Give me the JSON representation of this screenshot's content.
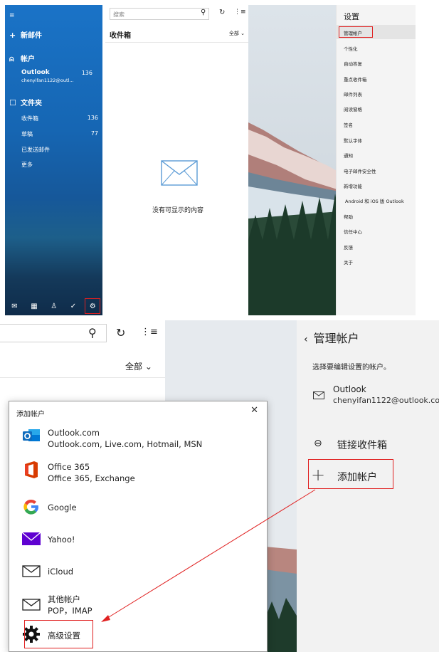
{
  "top": {
    "sidebar": {
      "new_mail": "新邮件",
      "accounts_header": "帐户",
      "account_name": "Outlook",
      "account_email": "chenyifan1122@outl...",
      "account_count": "136",
      "folders_header": "文件夹",
      "folders": [
        {
          "label": "收件箱",
          "count": "136"
        },
        {
          "label": "草稿",
          "count": "77"
        },
        {
          "label": "已发送邮件",
          "count": ""
        },
        {
          "label": "更多",
          "count": ""
        }
      ]
    },
    "maillist": {
      "search_placeholder": "搜索",
      "inbox_title": "收件箱",
      "filter": "全部",
      "empty_text": "没有可显示的内容"
    },
    "settings": {
      "title": "设置",
      "items": [
        "管理帐户",
        "个性化",
        "自动答复",
        "重点收件箱",
        "邮件列表",
        "阅读窗格",
        "签名",
        "默认字体",
        "通知",
        "电子邮件安全性",
        "新增功能",
        "Android 和 iOS 版 Outlook",
        "帮助",
        "信任中心",
        "反馈",
        "关于"
      ]
    }
  },
  "bottom": {
    "filter": "全部",
    "manage": {
      "title": "管理帐户",
      "subtitle": "选择要编辑设置的帐户。",
      "account_name": "Outlook",
      "account_email": "chenyifan1122@outlook.com",
      "link_inbox": "链接收件箱",
      "add_account": "添加帐户"
    },
    "dialog": {
      "title": "添加帐户",
      "providers": [
        {
          "name": "Outlook.com",
          "desc": "Outlook.com, Live.com, Hotmail, MSN",
          "icon": "outlook-icon"
        },
        {
          "name": "Office 365",
          "desc": "Office 365, Exchange",
          "icon": "office-icon"
        },
        {
          "name": "Google",
          "desc": "",
          "icon": "google-icon"
        },
        {
          "name": "Yahoo!",
          "desc": "",
          "icon": "yahoo-icon"
        },
        {
          "name": "iCloud",
          "desc": "",
          "icon": "envelope-icon"
        },
        {
          "name": "其他帐户",
          "desc": "POP，IMAP",
          "icon": "envelope-icon"
        },
        {
          "name": "高级设置",
          "desc": "",
          "icon": "gear-icon"
        }
      ]
    }
  },
  "colors": {
    "sidebar": "#1a73c7",
    "highlight": "#e02020",
    "yahoo": "#5f01d1",
    "office": "#d83b01",
    "outlook": "#0f6cbd"
  }
}
